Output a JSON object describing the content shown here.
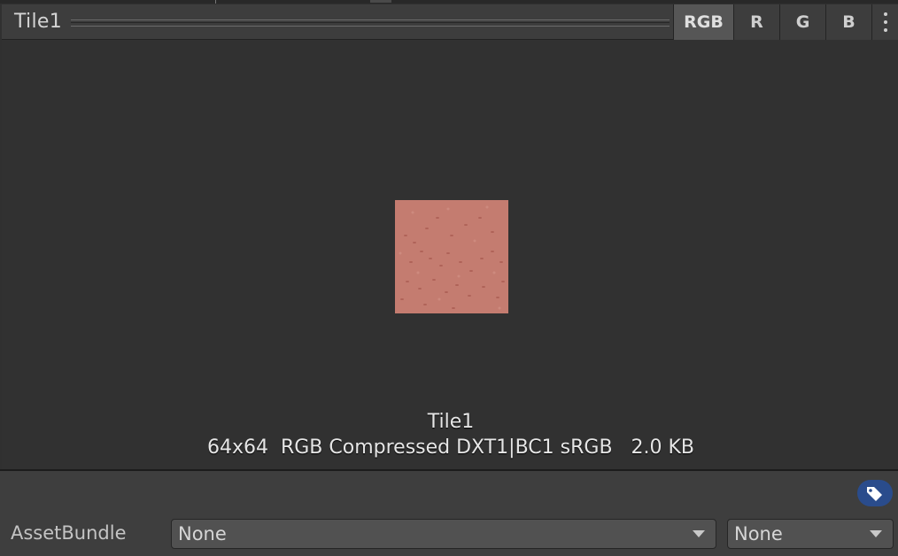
{
  "header": {
    "title": "Tile1",
    "channels": [
      "RGB",
      "R",
      "G",
      "B"
    ],
    "active_channel": "RGB",
    "more_icon": "kebab-menu-icon"
  },
  "preview": {
    "texture_color": "#c47c70",
    "name": "Tile1",
    "details": "64x64  RGB Compressed DXT1|BC1 sRGB   2.0 KB"
  },
  "asset": {
    "label_icon": "tag-icon",
    "label_icon_color": "#2a4c8c",
    "asset_bundle_label": "AssetBundle",
    "asset_bundle_value": "None",
    "variant_value": "None"
  }
}
